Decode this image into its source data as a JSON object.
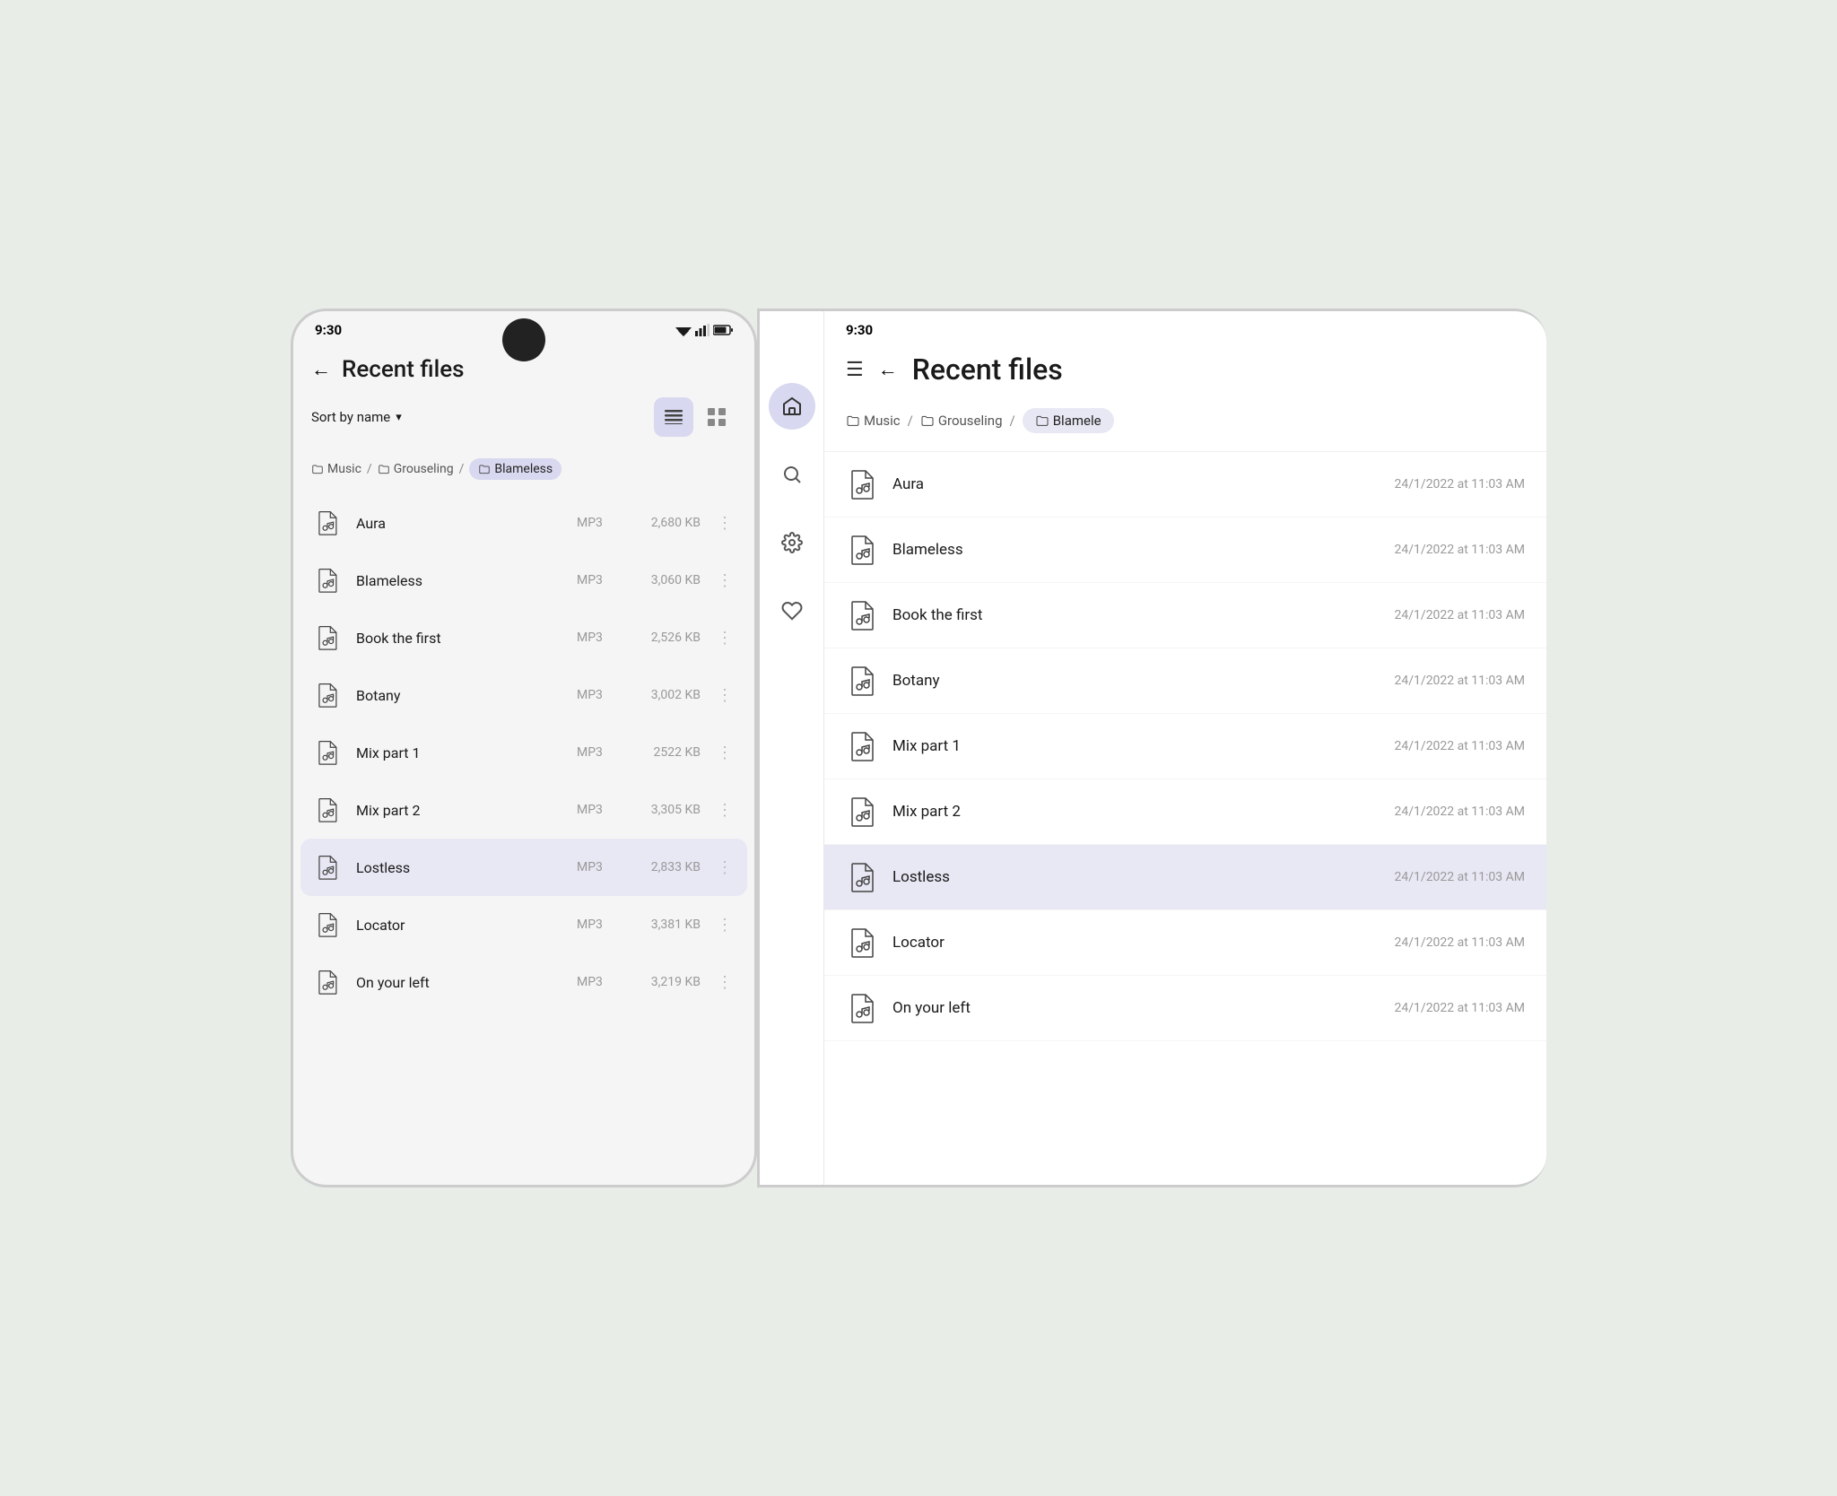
{
  "colors": {
    "active_bg": "#d8d8f0",
    "selected_row": "#e8e8f5",
    "text_primary": "#1a1a1a",
    "text_secondary": "#999",
    "accent": "#5c5c9e"
  },
  "phone": {
    "status_time": "9:30",
    "back_label": "←",
    "title": "Recent files",
    "sort_label": "Sort by name",
    "view_list_label": "≡",
    "view_grid_label": "⊞",
    "breadcrumb": [
      {
        "label": "Music",
        "active": false
      },
      {
        "label": "Grouseling",
        "active": false
      },
      {
        "label": "Blameless",
        "active": true
      }
    ],
    "files": [
      {
        "name": "Aura",
        "type": "MP3",
        "size": "2,680 KB",
        "selected": false
      },
      {
        "name": "Blameless",
        "type": "MP3",
        "size": "3,060 KB",
        "selected": false
      },
      {
        "name": "Book the first",
        "type": "MP3",
        "size": "2,526 KB",
        "selected": false
      },
      {
        "name": "Botany",
        "type": "MP3",
        "size": "3,002 KB",
        "selected": false
      },
      {
        "name": "Mix part 1",
        "type": "MP3",
        "size": "2522 KB",
        "selected": false
      },
      {
        "name": "Mix part 2",
        "type": "MP3",
        "size": "3,305 KB",
        "selected": false
      },
      {
        "name": "Lostless",
        "type": "MP3",
        "size": "2,833 KB",
        "selected": true
      },
      {
        "name": "Locator",
        "type": "MP3",
        "size": "3,381 KB",
        "selected": false
      },
      {
        "name": "On your left",
        "type": "MP3",
        "size": "3,219 KB",
        "selected": false
      }
    ]
  },
  "tablet": {
    "status_time": "9:30",
    "title": "Recent files",
    "breadcrumb": [
      {
        "label": "Music",
        "active": false
      },
      {
        "label": "Grouseling",
        "active": false
      },
      {
        "label": "Blamele",
        "active": true
      }
    ],
    "files": [
      {
        "name": "Aura",
        "date": "24/1/2022 at 11:03 AM",
        "selected": false
      },
      {
        "name": "Blameless",
        "date": "24/1/2022 at 11:03 AM",
        "selected": false
      },
      {
        "name": "Book the first",
        "date": "24/1/2022 at 11:03 AM",
        "selected": false
      },
      {
        "name": "Botany",
        "date": "24/1/2022 at 11:03 AM",
        "selected": false
      },
      {
        "name": "Mix part 1",
        "date": "24/1/2022 at 11:03 AM",
        "selected": false
      },
      {
        "name": "Mix part 2",
        "date": "24/1/2022 at 11:03 AM",
        "selected": false
      },
      {
        "name": "Lostless",
        "date": "24/1/2022 at 11:03 AM",
        "selected": true
      },
      {
        "name": "Locator",
        "date": "24/1/2022 at 11:03 AM",
        "selected": false
      },
      {
        "name": "On your left",
        "date": "24/1/2022 at 11:03 AM",
        "selected": false
      }
    ],
    "sidebar": {
      "items": [
        {
          "icon": "home",
          "label": "Home",
          "active": true
        },
        {
          "icon": "search",
          "label": "Search",
          "active": false
        },
        {
          "icon": "settings",
          "label": "Settings",
          "active": false
        },
        {
          "icon": "favorites",
          "label": "Favorites",
          "active": false
        }
      ]
    }
  }
}
